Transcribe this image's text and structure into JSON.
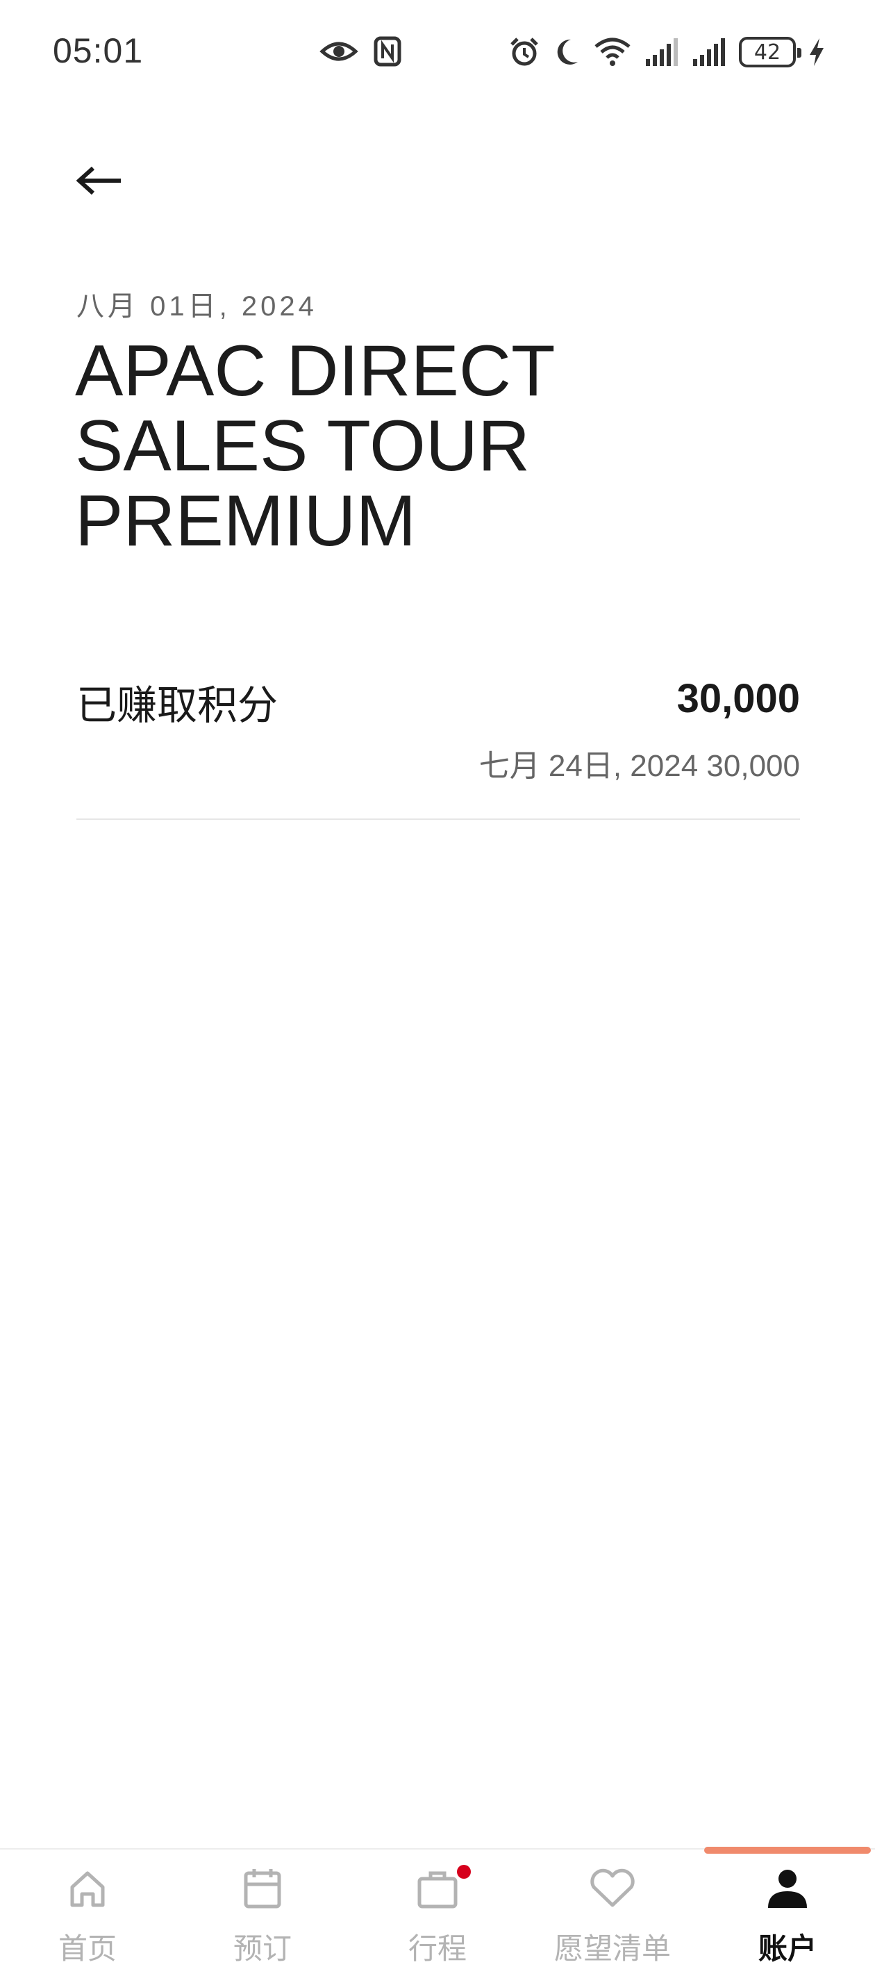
{
  "status_bar": {
    "time": "05:01",
    "battery_level": "42",
    "icons": [
      "eye-icon",
      "nfc-icon",
      "alarm-icon",
      "moon-icon",
      "wifi-icon",
      "signal-icon",
      "signal-icon",
      "battery-icon",
      "charging-icon"
    ]
  },
  "header": {
    "back_icon": "arrow-left-icon",
    "date": "八月 01日, 2024",
    "title": "APAC DIRECT\nSALES TOUR\nPREMIUM"
  },
  "points": {
    "label": "已赚取积分",
    "value": "30,000",
    "detail": "七月 24日, 2024 30,000"
  },
  "bottom_nav": {
    "items": [
      {
        "label": "首页",
        "icon": "home-icon",
        "active": false
      },
      {
        "label": "预订",
        "icon": "calendar-icon",
        "active": false
      },
      {
        "label": "行程",
        "icon": "briefcase-icon",
        "active": false,
        "badge": true
      },
      {
        "label": "愿望清单",
        "icon": "heart-icon",
        "active": false
      },
      {
        "label": "账户",
        "icon": "person-icon",
        "active": true
      }
    ],
    "indicator_color": "#f08a6c",
    "badge_color": "#d6001c"
  }
}
